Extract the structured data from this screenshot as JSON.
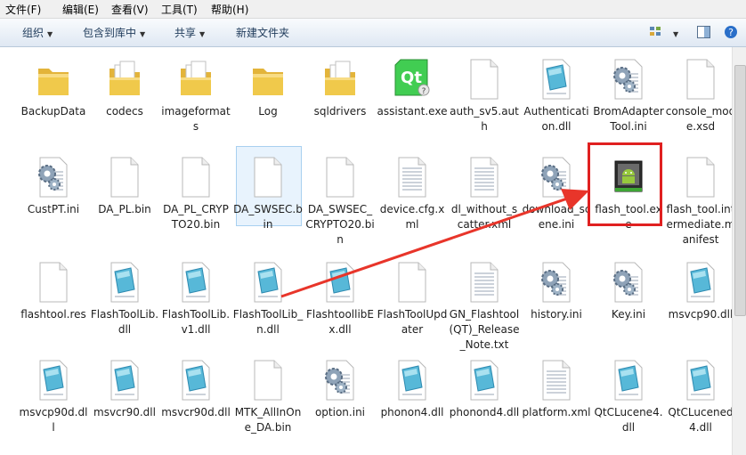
{
  "menubar": [
    {
      "label": "文件(F)"
    },
    {
      "label": "编辑(E)"
    },
    {
      "label": "查看(V)"
    },
    {
      "label": "工具(T)"
    },
    {
      "label": "帮助(H)"
    }
  ],
  "toolbar": {
    "organize": "组织",
    "include_in_library": "包含到库中",
    "share": "共享",
    "new_folder": "新建文件夹"
  },
  "colors": {
    "highlight": "#e02020",
    "arrow": "#e8352a",
    "folder": "#f0c94b"
  },
  "files": [
    {
      "label": "BackupData",
      "icon": "folder"
    },
    {
      "label": "codecs",
      "icon": "folder-docs"
    },
    {
      "label": "imageformats",
      "icon": "folder-docs"
    },
    {
      "label": "Log",
      "icon": "folder"
    },
    {
      "label": "sqldrivers",
      "icon": "folder-docs"
    },
    {
      "label": "assistant.exe",
      "icon": "qt-app"
    },
    {
      "label": "auth_sv5.auth",
      "icon": "blank-file"
    },
    {
      "label": "Authentication.dll",
      "icon": "dll"
    },
    {
      "label": "BromAdapterTool.ini",
      "icon": "ini-gear"
    },
    {
      "label": "console_mode.xsd",
      "icon": "blank-file"
    },
    {
      "label": "CustPT.ini",
      "icon": "ini-gear"
    },
    {
      "label": "DA_PL.bin",
      "icon": "blank-file"
    },
    {
      "label": "DA_PL_CRYPTO20.bin",
      "icon": "blank-file"
    },
    {
      "label": "DA_SWSEC.bin",
      "icon": "blank-file"
    },
    {
      "label": "DA_SWSEC_CRYPTO20.bin",
      "icon": "blank-file"
    },
    {
      "label": "device.cfg.xml",
      "icon": "text-file"
    },
    {
      "label": "dl_without_scatter.xml",
      "icon": "text-file"
    },
    {
      "label": "download_scene.ini",
      "icon": "ini-gear"
    },
    {
      "label": "flash_tool.exe",
      "icon": "android-app"
    },
    {
      "label": "flash_tool.intermediate.manifest",
      "icon": "blank-file"
    },
    {
      "label": "flashtool.res",
      "icon": "blank-file"
    },
    {
      "label": "FlashToolLib.dll",
      "icon": "dll"
    },
    {
      "label": "FlashToolLib.v1.dll",
      "icon": "dll"
    },
    {
      "label": "FlashToolLib_n.dll",
      "icon": "dll"
    },
    {
      "label": "FlashtoollibEx.dll",
      "icon": "dll"
    },
    {
      "label": "FlashToolUpdater",
      "icon": "blank-file"
    },
    {
      "label": "GN_Flashtool(QT)_Release_Note.txt",
      "icon": "text-file"
    },
    {
      "label": "history.ini",
      "icon": "ini-gear"
    },
    {
      "label": "Key.ini",
      "icon": "ini-gear"
    },
    {
      "label": "msvcp90.dll",
      "icon": "dll"
    },
    {
      "label": "msvcp90d.dll",
      "icon": "dll"
    },
    {
      "label": "msvcr90.dll",
      "icon": "dll"
    },
    {
      "label": "msvcr90d.dll",
      "icon": "dll"
    },
    {
      "label": "MTK_AllInOne_DA.bin",
      "icon": "blank-file"
    },
    {
      "label": "option.ini",
      "icon": "ini-gear"
    },
    {
      "label": "phonon4.dll",
      "icon": "dll"
    },
    {
      "label": "phonond4.dll",
      "icon": "dll"
    },
    {
      "label": "platform.xml",
      "icon": "text-file"
    },
    {
      "label": "QtCLucene4.dll",
      "icon": "dll"
    },
    {
      "label": "QtCLucened4.dll",
      "icon": "dll"
    }
  ]
}
